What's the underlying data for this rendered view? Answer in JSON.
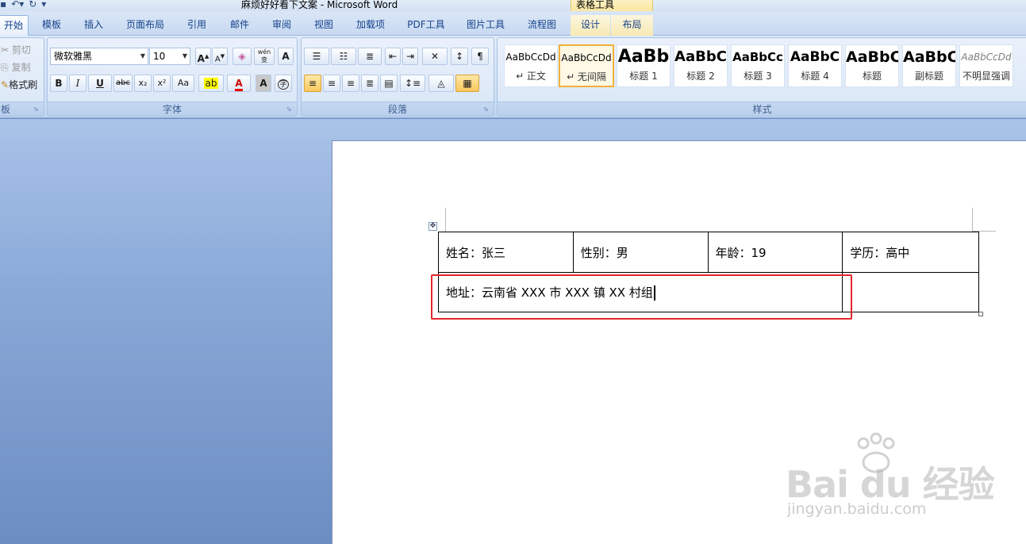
{
  "window": {
    "title": "麻烦好好看下文案 - Microsoft Word",
    "context_tab_label": "表格工具"
  },
  "tabs": [
    "开始",
    "模板",
    "插入",
    "页面布局",
    "引用",
    "邮件",
    "审阅",
    "视图",
    "加载项",
    "PDF工具",
    "图片工具",
    "流程图",
    "设计",
    "布局"
  ],
  "ribbon": {
    "clipboard": {
      "cut": "剪切",
      "copy": "复制",
      "format_painter": "格式刷",
      "label": "板"
    },
    "font": {
      "font_name": "微软雅黑",
      "font_size": "10",
      "label": "字体",
      "bold": "B",
      "italic": "I",
      "underline": "U",
      "strikethrough": "abc",
      "subscript": "x₂",
      "superscript": "x²",
      "change_case": "Aa",
      "grow": "A",
      "shrink": "A",
      "font_color": "A",
      "char_shading": "A",
      "enclose": "字",
      "phonetic": "wén",
      "phonetic_char": "变"
    },
    "paragraph": {
      "label": "段落"
    },
    "styles": {
      "label": "样式",
      "items": [
        {
          "sample": "AaBbCcDd",
          "name": "↵ 正文"
        },
        {
          "sample": "AaBbCcDd",
          "name": "↵ 无间隔"
        },
        {
          "sample": "AaBb",
          "name": "标题 1"
        },
        {
          "sample": "AaBbC",
          "name": "标题 2"
        },
        {
          "sample": "AaBbCc",
          "name": "标题 3"
        },
        {
          "sample": "AaBbC",
          "name": "标题 4"
        },
        {
          "sample": "AaBbC",
          "name": "标题"
        },
        {
          "sample": "AaBbC",
          "name": "副标题"
        },
        {
          "sample": "AaBbCcDd",
          "name": "不明显强调"
        }
      ]
    }
  },
  "document": {
    "table": {
      "row1": [
        "姓名：张三",
        "性别：男",
        "年龄：19",
        "学历：高中"
      ],
      "row2": "地址：云南省 XXX 市 XXX 镇 XX 村组"
    }
  },
  "watermark": {
    "brand": "Bai du 经验",
    "url": "jingyan.baidu.com"
  },
  "colors": {
    "highlight_box": "#e5262b",
    "ribbon_text": "#15428b",
    "selected_style_border": "#f2b03a"
  }
}
